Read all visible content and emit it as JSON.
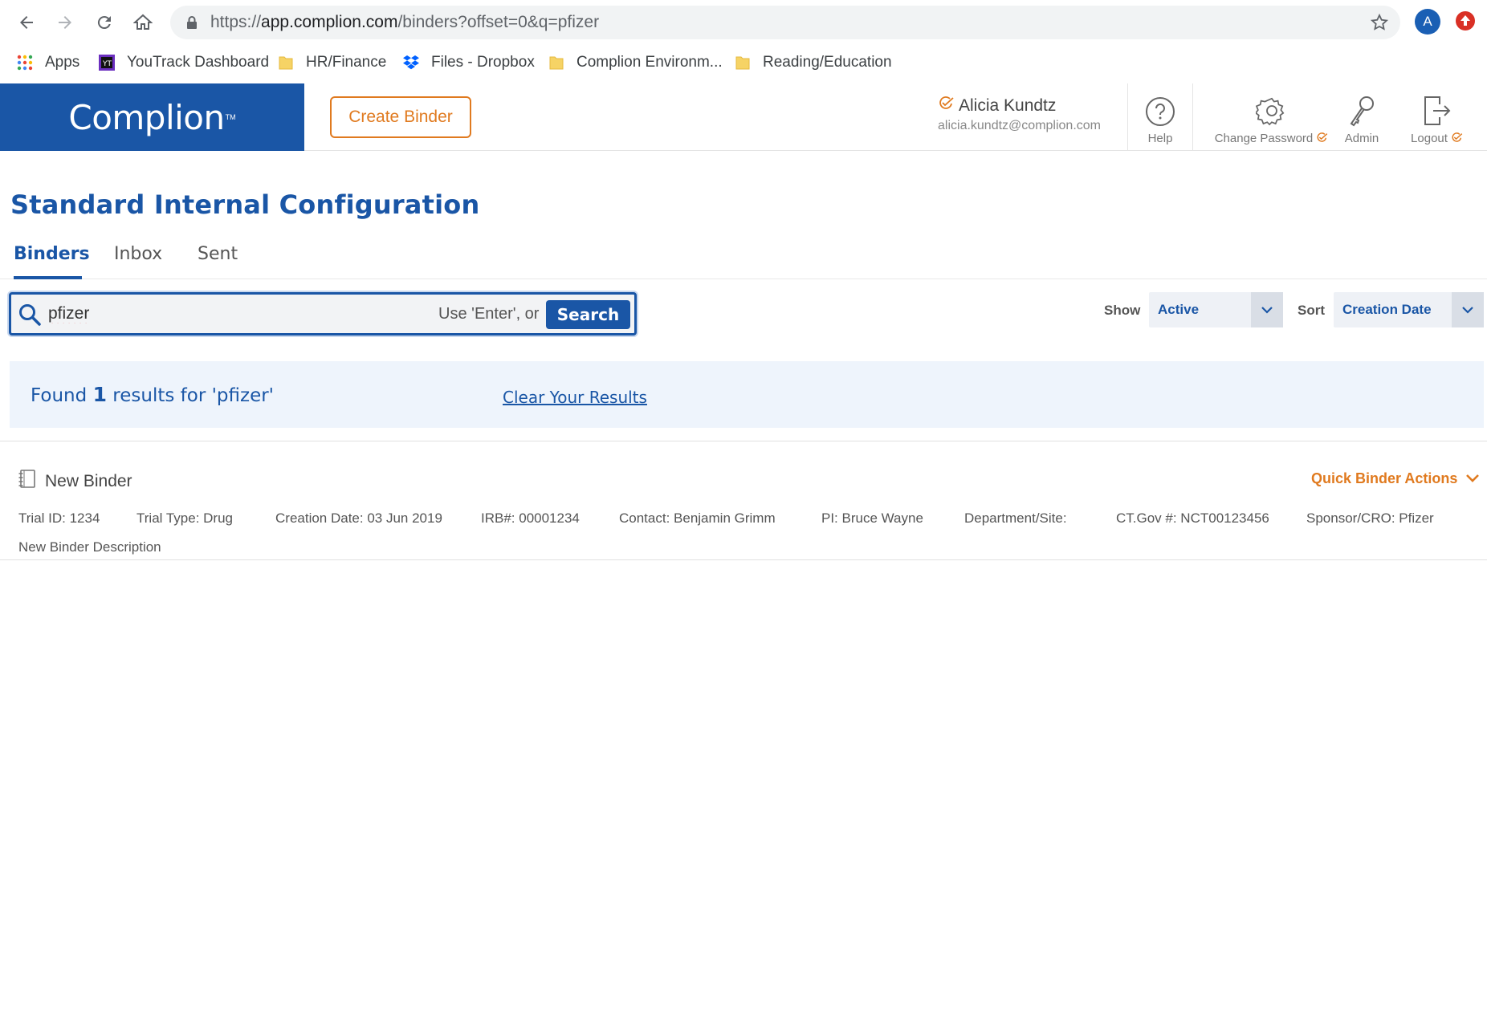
{
  "browser": {
    "url_prefix": "https://",
    "url_domain": "app.complion.com",
    "url_path": "/binders?offset=0&q=pfizer",
    "profile_initial": "A",
    "bookmarks": [
      {
        "label": "Apps",
        "icon": "apps-grid-icon"
      },
      {
        "label": "YouTrack Dashboard",
        "icon": "youtrack-icon"
      },
      {
        "label": "HR/Finance",
        "icon": "folder-icon"
      },
      {
        "label": "Files - Dropbox",
        "icon": "dropbox-icon"
      },
      {
        "label": "Complion Environm...",
        "icon": "folder-icon"
      },
      {
        "label": "Reading/Education",
        "icon": "folder-icon"
      }
    ]
  },
  "header": {
    "logo": "Complion",
    "create_binder": "Create Binder",
    "user_name": "Alicia Kundtz",
    "user_email": "alicia.kundtz@complion.com",
    "help": "Help",
    "change_password": "Change Password",
    "admin": "Admin",
    "logout": "Logout"
  },
  "page": {
    "title": "Standard Internal Configuration",
    "tabs": [
      "Binders",
      "Inbox",
      "Sent"
    ],
    "active_tab": "Binders"
  },
  "search": {
    "value": "pfizer",
    "hint": "Use 'Enter', or",
    "button": "Search"
  },
  "filters": {
    "show_label": "Show",
    "show_value": "Active",
    "sort_label": "Sort",
    "sort_value": "Creation Date"
  },
  "results": {
    "prefix": "Found",
    "count": "1",
    "suffix": "results for 'pfizer'",
    "clear_link": "Clear Your Results"
  },
  "binders": [
    {
      "name": "New Binder",
      "quick_actions": "Quick Binder Actions",
      "meta": [
        "Trial ID: 1234",
        "Trial Type: Drug",
        "Creation Date: 03 Jun 2019",
        "IRB#: 00001234",
        "Contact: Benjamin Grimm",
        "PI: Bruce Wayne",
        "Department/Site:",
        "CT.Gov #: NCT00123456",
        "Sponsor/CRO: Pfizer"
      ],
      "description": "New Binder Description"
    }
  ],
  "colors": {
    "brand_blue": "#1a56a6",
    "accent_orange": "#e07a1f",
    "results_bg": "#eef4fc"
  }
}
